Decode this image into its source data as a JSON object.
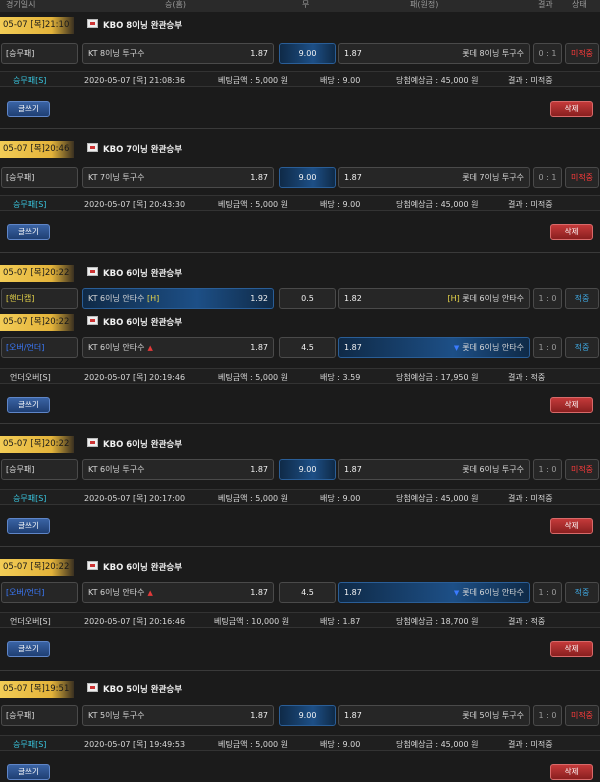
{
  "header": {
    "date": "경기일시",
    "win": "승(홈)",
    "draw": "무",
    "lose": "패(원정)",
    "result": "결과",
    "status": "상태"
  },
  "buttons": {
    "write": "글쓰기",
    "delete": "삭제"
  },
  "info_labels": {
    "bet": "베팅금액 : ",
    "odds": "배당 : ",
    "expected": "당첨예상금 : ",
    "result": "결과 : "
  },
  "sections": [
    {
      "date": "05-07 [목]21:10",
      "title": "KBO 8이닝 완관승부",
      "rows": [
        {
          "type": "[승무패]",
          "home": "KT 8이닝 투구수",
          "home_odd": "1.87",
          "center": "9.00",
          "away": "롯데 8이닝 투구수",
          "away_odd": "1.87",
          "score": "0 : 1",
          "status": "미적중"
        }
      ],
      "info": {
        "type": "승무패[S]",
        "time": "2020-05-07 [목] 21:08:36",
        "bet": "5,000 원",
        "odds": "9.00",
        "expected": "45,000 원",
        "result": "미적중"
      }
    },
    {
      "date": "05-07 [목]20:46",
      "title": "KBO 7이닝 완관승부",
      "rows": [
        {
          "type": "[승무패]",
          "home": "KT 7이닝 투구수",
          "home_odd": "1.87",
          "center": "9.00",
          "away": "롯데 7이닝 투구수",
          "away_odd": "1.87",
          "score": "0 : 1",
          "status": "미적중"
        }
      ],
      "info": {
        "type": "승무패[S]",
        "time": "2020-05-07 [목] 20:43:30",
        "bet": "5,000 원",
        "odds": "9.00",
        "expected": "45,000 원",
        "result": "미적중"
      }
    },
    {
      "date": "05-07 [목]20:22",
      "title": "KBO 6이닝 완관승부",
      "rows": [
        {
          "type": "[핸디캡]",
          "home": "KT 6이닝 안타수",
          "home_tag": "[H]",
          "home_odd": "1.92",
          "center": "0.5",
          "away": "롯데 6이닝 안타수",
          "away_tag": "[H]",
          "away_odd": "1.82",
          "score": "1 : 0",
          "status": "적중"
        }
      ]
    },
    {
      "date": "05-07 [목]20:22",
      "title": "KBO 6이닝 완관승부",
      "rows": [
        {
          "type": "[오버/언더]",
          "home": "KT 6이닝 안타수",
          "home_odd": "1.87",
          "center": "4.5",
          "away": "롯데 6이닝 안타수",
          "away_odd": "1.87",
          "score": "1 : 0",
          "status": "적중"
        }
      ],
      "info": {
        "type": "언더오버[S]",
        "time": "2020-05-07 [목] 20:19:46",
        "bet": "5,000 원",
        "odds": "3.59",
        "expected": "17,950 원",
        "result": "적중"
      }
    },
    {
      "date": "05-07 [목]20:22",
      "title": "KBO 6이닝 완관승부",
      "rows": [
        {
          "type": "[승무패]",
          "home": "KT 6이닝 투구수",
          "home_odd": "1.87",
          "center": "9.00",
          "away": "롯데 6이닝 투구수",
          "away_odd": "1.87",
          "score": "1 : 0",
          "status": "미적중"
        }
      ],
      "info": {
        "type": "승무패[S]",
        "time": "2020-05-07 [목] 20:17:00",
        "bet": "5,000 원",
        "odds": "9.00",
        "expected": "45,000 원",
        "result": "미적중"
      }
    },
    {
      "date": "05-07 [목]20:22",
      "title": "KBO 6이닝 완관승부",
      "rows": [
        {
          "type": "[오버/언더]",
          "home": "KT 6이닝 안타수",
          "home_odd": "1.87",
          "center": "4.5",
          "away": "롯데 6이닝 안타수",
          "away_odd": "1.87",
          "score": "1 : 0",
          "status": "적중"
        }
      ],
      "info": {
        "type": "언더오버[S]",
        "time": "2020-05-07 [목] 20:16:46",
        "bet": "10,000 원",
        "odds": "1.87",
        "expected": "18,700 원",
        "result": "적중"
      }
    },
    {
      "date": "05-07 [목]19:51",
      "title": "KBO 5이닝 완관승부",
      "rows": [
        {
          "type": "[승무패]",
          "home": "KT 5이닝 투구수",
          "home_odd": "1.87",
          "center": "9.00",
          "away": "롯데 5이닝 투구수",
          "away_odd": "1.87",
          "score": "1 : 0",
          "status": "미적중"
        }
      ],
      "info": {
        "type": "승무패[S]",
        "time": "2020-05-07 [목] 19:49:53",
        "bet": "5,000 원",
        "odds": "9.00",
        "expected": "45,000 원",
        "result": "미적중"
      }
    }
  ]
}
